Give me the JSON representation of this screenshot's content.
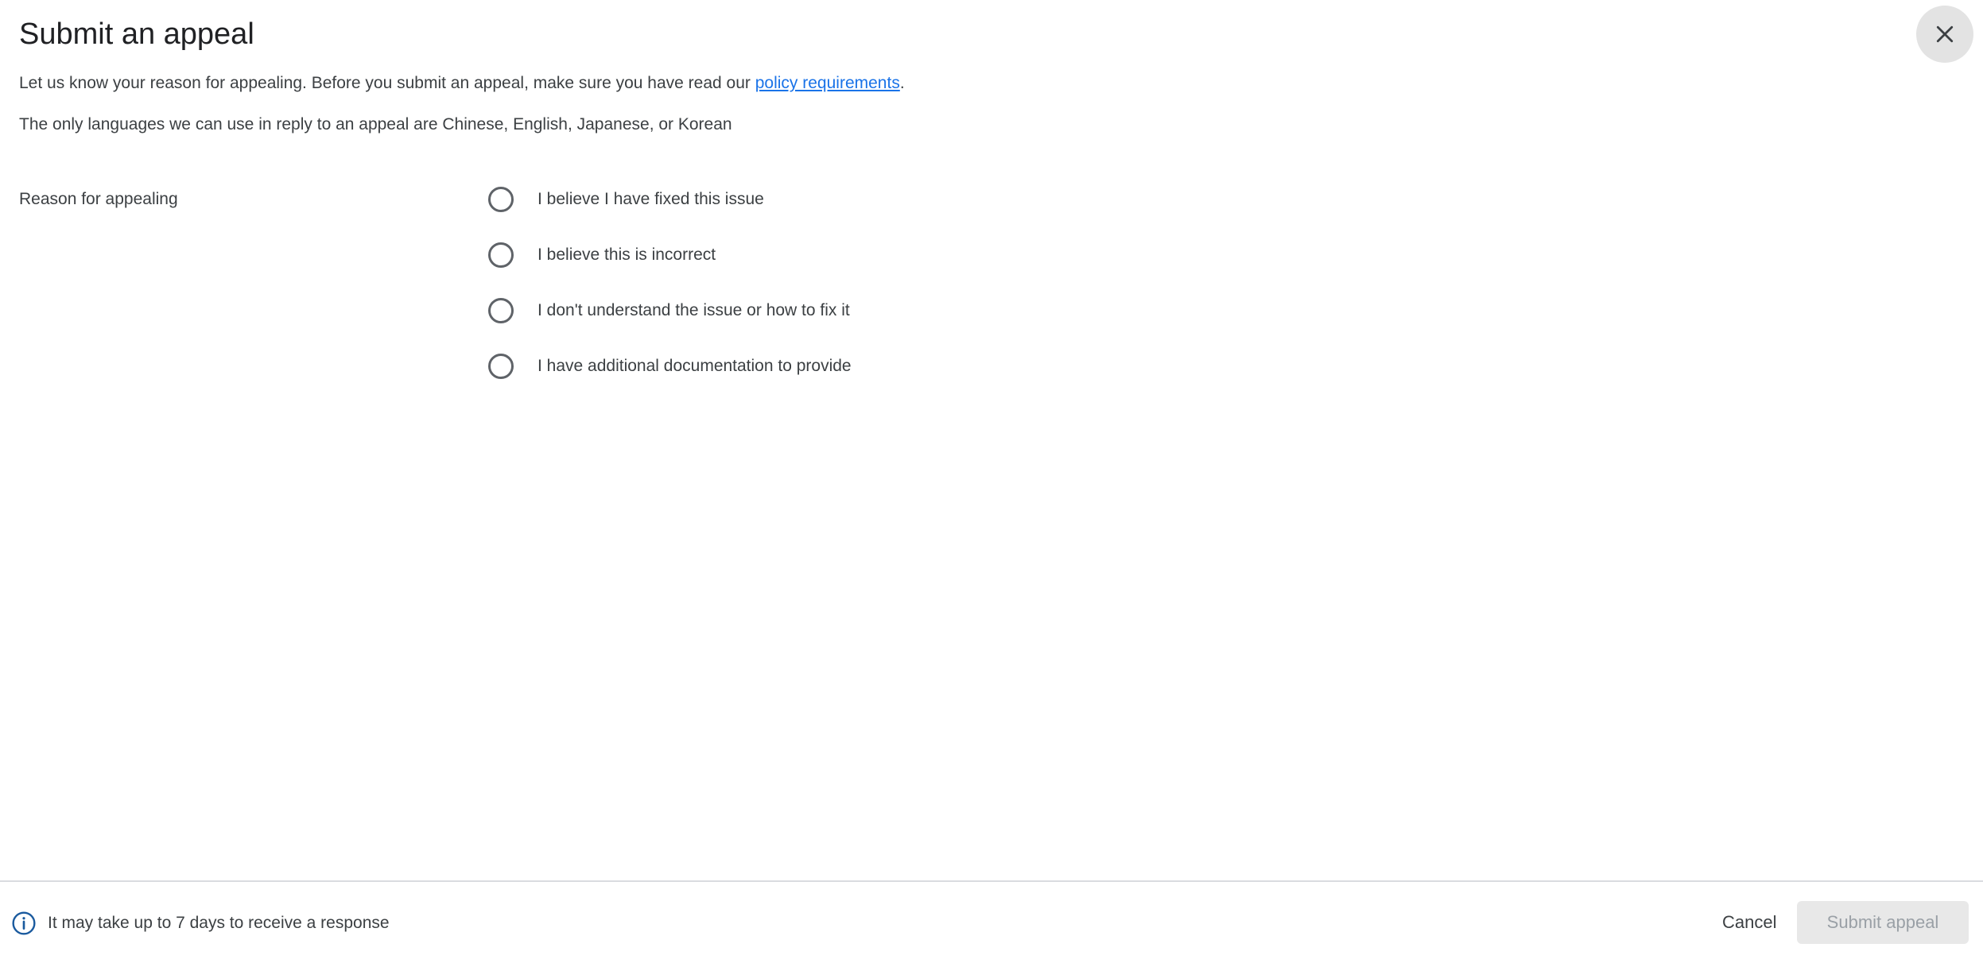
{
  "dialog": {
    "title": "Submit an appeal",
    "close_label": "Close"
  },
  "intro": {
    "text_before_link": "Let us know your reason for appealing. Before you submit an appeal, make sure you have read our ",
    "link_text": "policy requirements",
    "text_after_link": "."
  },
  "language_note": "The only languages we can use in reply to an appeal are Chinese, English, Japanese, or Korean",
  "reason": {
    "label": "Reason for appealing",
    "options": [
      {
        "label": "I believe I have fixed this issue",
        "selected": false
      },
      {
        "label": "I believe this is incorrect",
        "selected": false
      },
      {
        "label": "I don't understand the issue or how to fix it",
        "selected": false
      },
      {
        "label": "I have additional documentation to provide",
        "selected": false
      }
    ]
  },
  "footer": {
    "note": "It may take up to 7 days to receive a response",
    "cancel_label": "Cancel",
    "submit_label": "Submit appeal"
  },
  "colors": {
    "link": "#1a73e8",
    "info_icon": "#1a5a9e",
    "submit_disabled_bg": "#e8e8e8"
  }
}
